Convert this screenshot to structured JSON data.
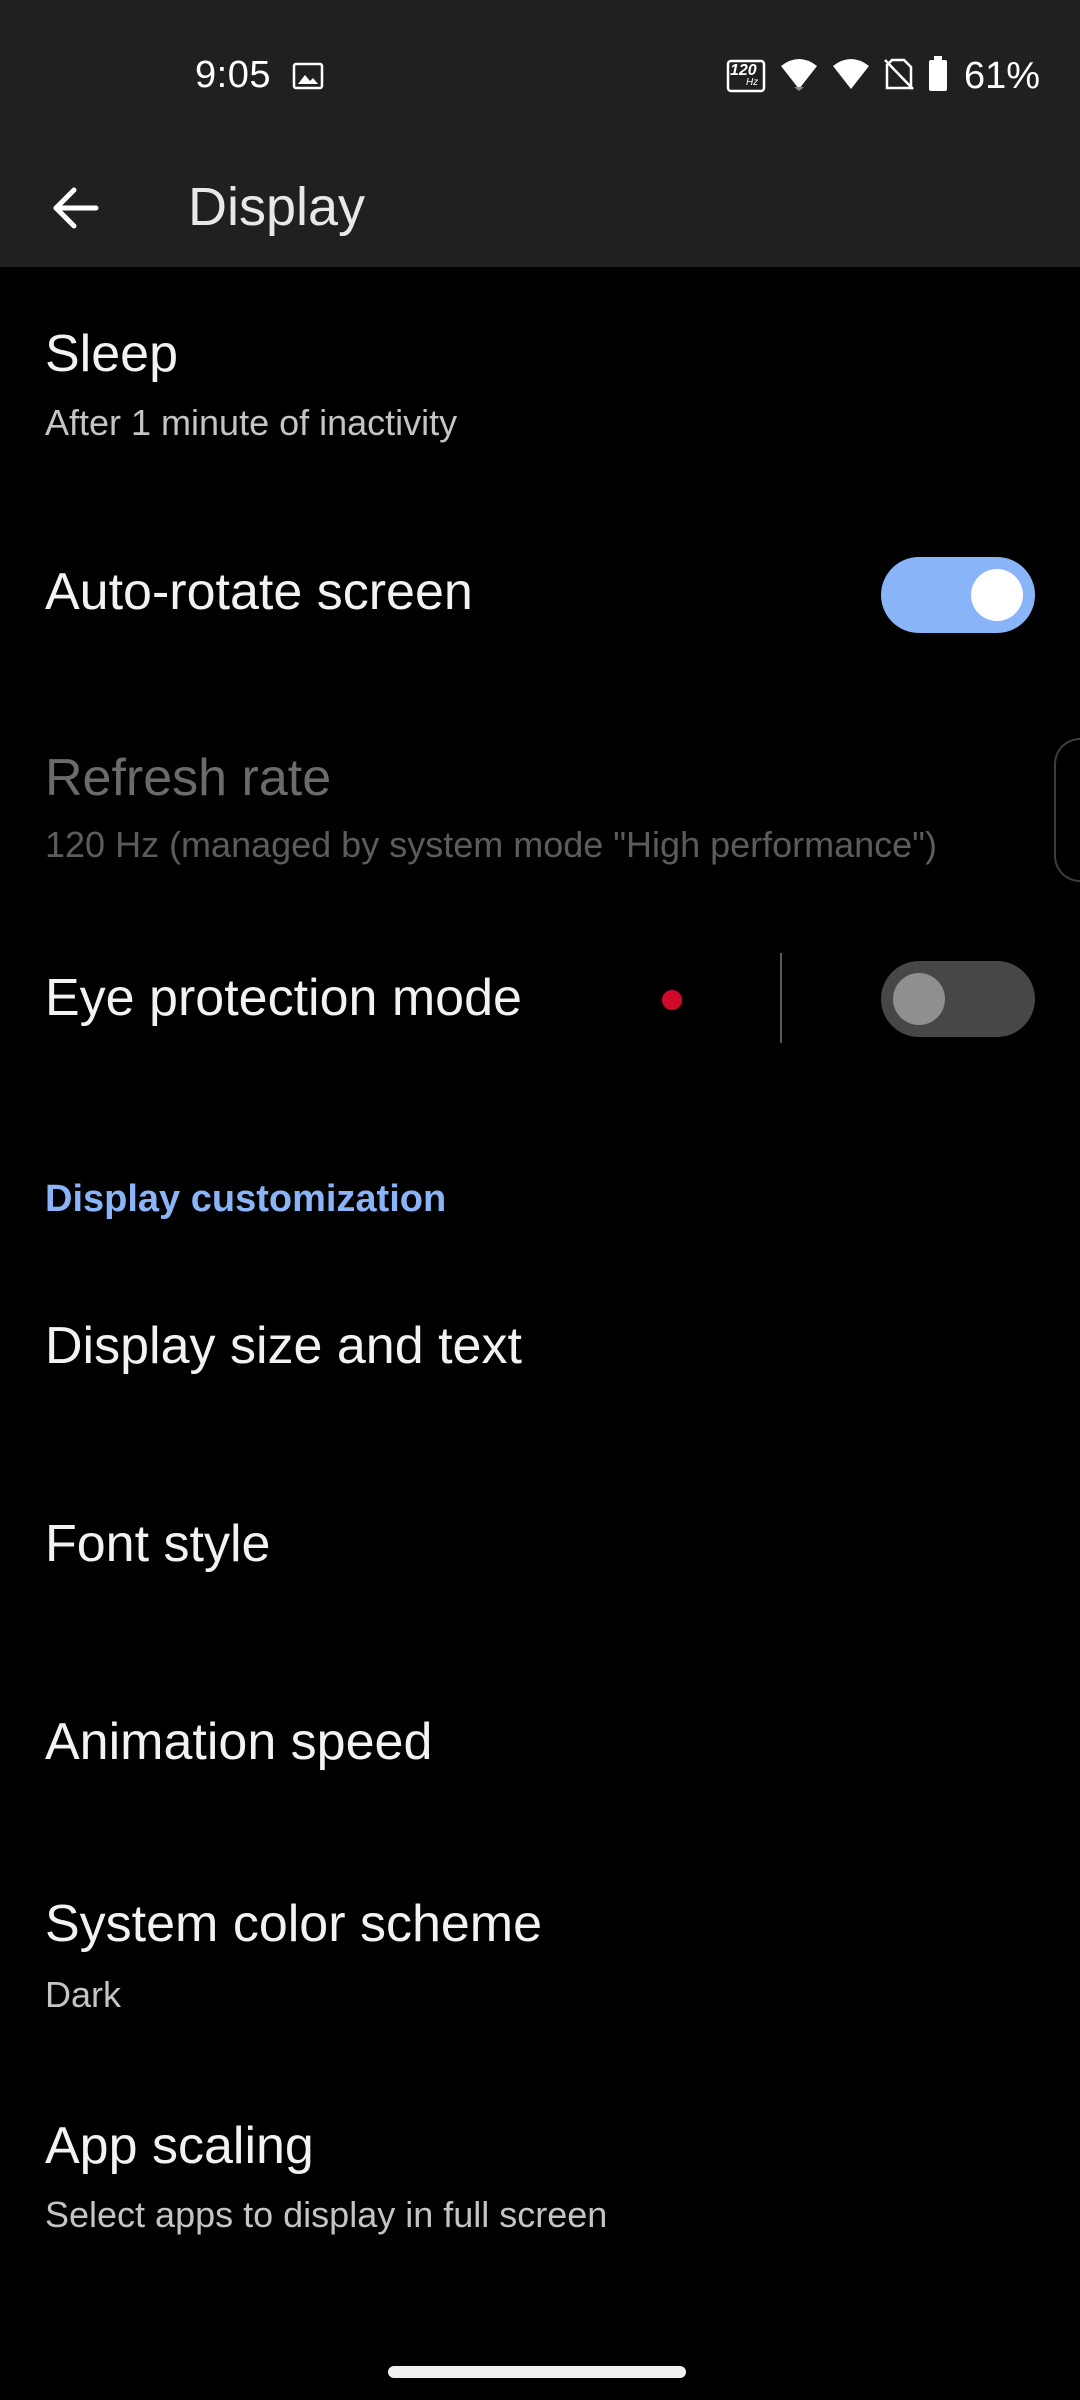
{
  "status_bar": {
    "time": "9:05",
    "refresh_badge": "120",
    "refresh_badge_unit": "Hz",
    "battery_percent": "61%",
    "icons": [
      "gallery-icon",
      "refresh-rate-icon",
      "wifi-icon",
      "signal-icon",
      "no-sim-icon",
      "battery-icon"
    ]
  },
  "app_bar": {
    "title": "Display",
    "back_icon": "arrow-back-icon"
  },
  "settings": {
    "sleep": {
      "title": "Sleep",
      "subtitle": "After 1 minute of inactivity"
    },
    "auto_rotate": {
      "title": "Auto-rotate screen",
      "enabled": true
    },
    "refresh_rate": {
      "title": "Refresh rate",
      "subtitle": "120 Hz (managed by system mode \"High performance\")",
      "disabled": true
    },
    "eye_protection": {
      "title": "Eye protection mode",
      "enabled": false
    },
    "section_display_customization": "Display customization",
    "display_size": {
      "title": "Display size and text"
    },
    "font_style": {
      "title": "Font style"
    },
    "animation_speed": {
      "title": "Animation speed"
    },
    "color_scheme": {
      "title": "System color scheme",
      "subtitle": "Dark"
    },
    "app_scaling": {
      "title": "App scaling",
      "subtitle": "Select apps to display in full screen"
    }
  },
  "colors": {
    "background": "#000000",
    "top_bar": "#202020",
    "accent": "#8ab4f8",
    "notification_dot": "#d10a2c",
    "toggle_off": "#474747"
  }
}
